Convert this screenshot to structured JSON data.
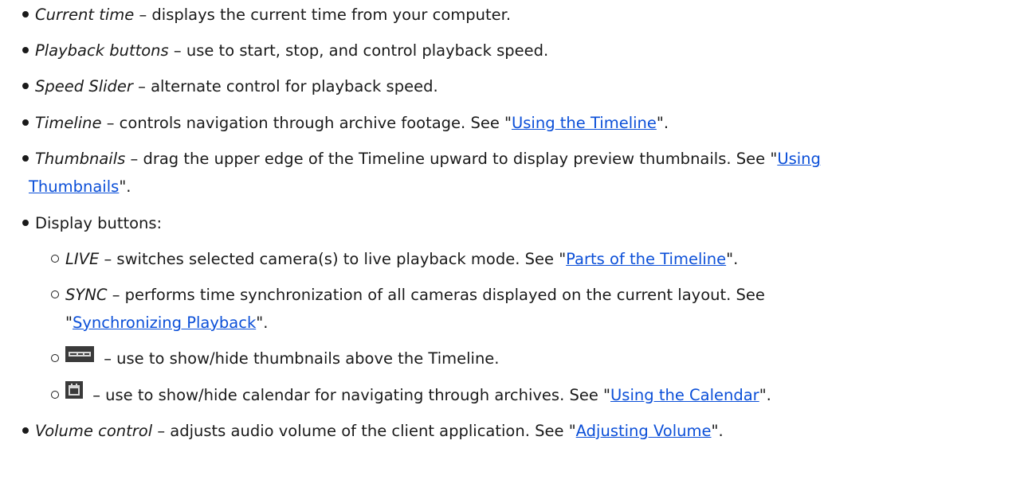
{
  "items": {
    "current_time": {
      "term": "Current time",
      "text": " – displays the current time from your computer."
    },
    "playback_buttons": {
      "term": "Playback buttons",
      "text": " – use to start, stop, and control playback speed."
    },
    "speed_slider": {
      "term": "Speed Slider",
      "text": " – alternate control for playback speed."
    },
    "timeline": {
      "term": "Timeline",
      "text": " – controls navigation through archive footage. See \"",
      "link": "Using the Timeline",
      "after": "\"."
    },
    "thumbnails": {
      "term": "Thumbnails",
      "text": " – drag the upper edge of the Timeline upward to display preview thumbnails. See \"",
      "link_part1": "Using",
      "link_part2": "Thumbnails",
      "after": "\"."
    },
    "display_buttons": {
      "text": "Display buttons:"
    },
    "live": {
      "term": "LIVE",
      "text": " – switches selected camera(s) to live playback mode. See \"",
      "link": "Parts of the Timeline",
      "after": "\"."
    },
    "sync": {
      "term": "SYNC",
      "text": " – performs time synchronization of all cameras displayed on the current layout. See",
      "before_link": "\"",
      "link": "Synchronizing Playback",
      "after": "\"."
    },
    "thumbs_toggle": {
      "icon": "thumbnails-icon",
      "text": " – use to show/hide thumbnails above the Timeline."
    },
    "calendar_toggle": {
      "icon": "calendar-icon",
      "text": " – use to show/hide calendar for navigating through archives. See \"",
      "link": "Using the Calendar",
      "after": "\"."
    },
    "volume_control": {
      "term": "Volume control",
      "text": " – adjusts audio volume of the client application. See \"",
      "link": "Adjusting Volume",
      "after": "\"."
    }
  },
  "colors": {
    "text": "#1a1a1a",
    "link": "#0b4fd8",
    "icon_bg": "#3a3a3a"
  }
}
